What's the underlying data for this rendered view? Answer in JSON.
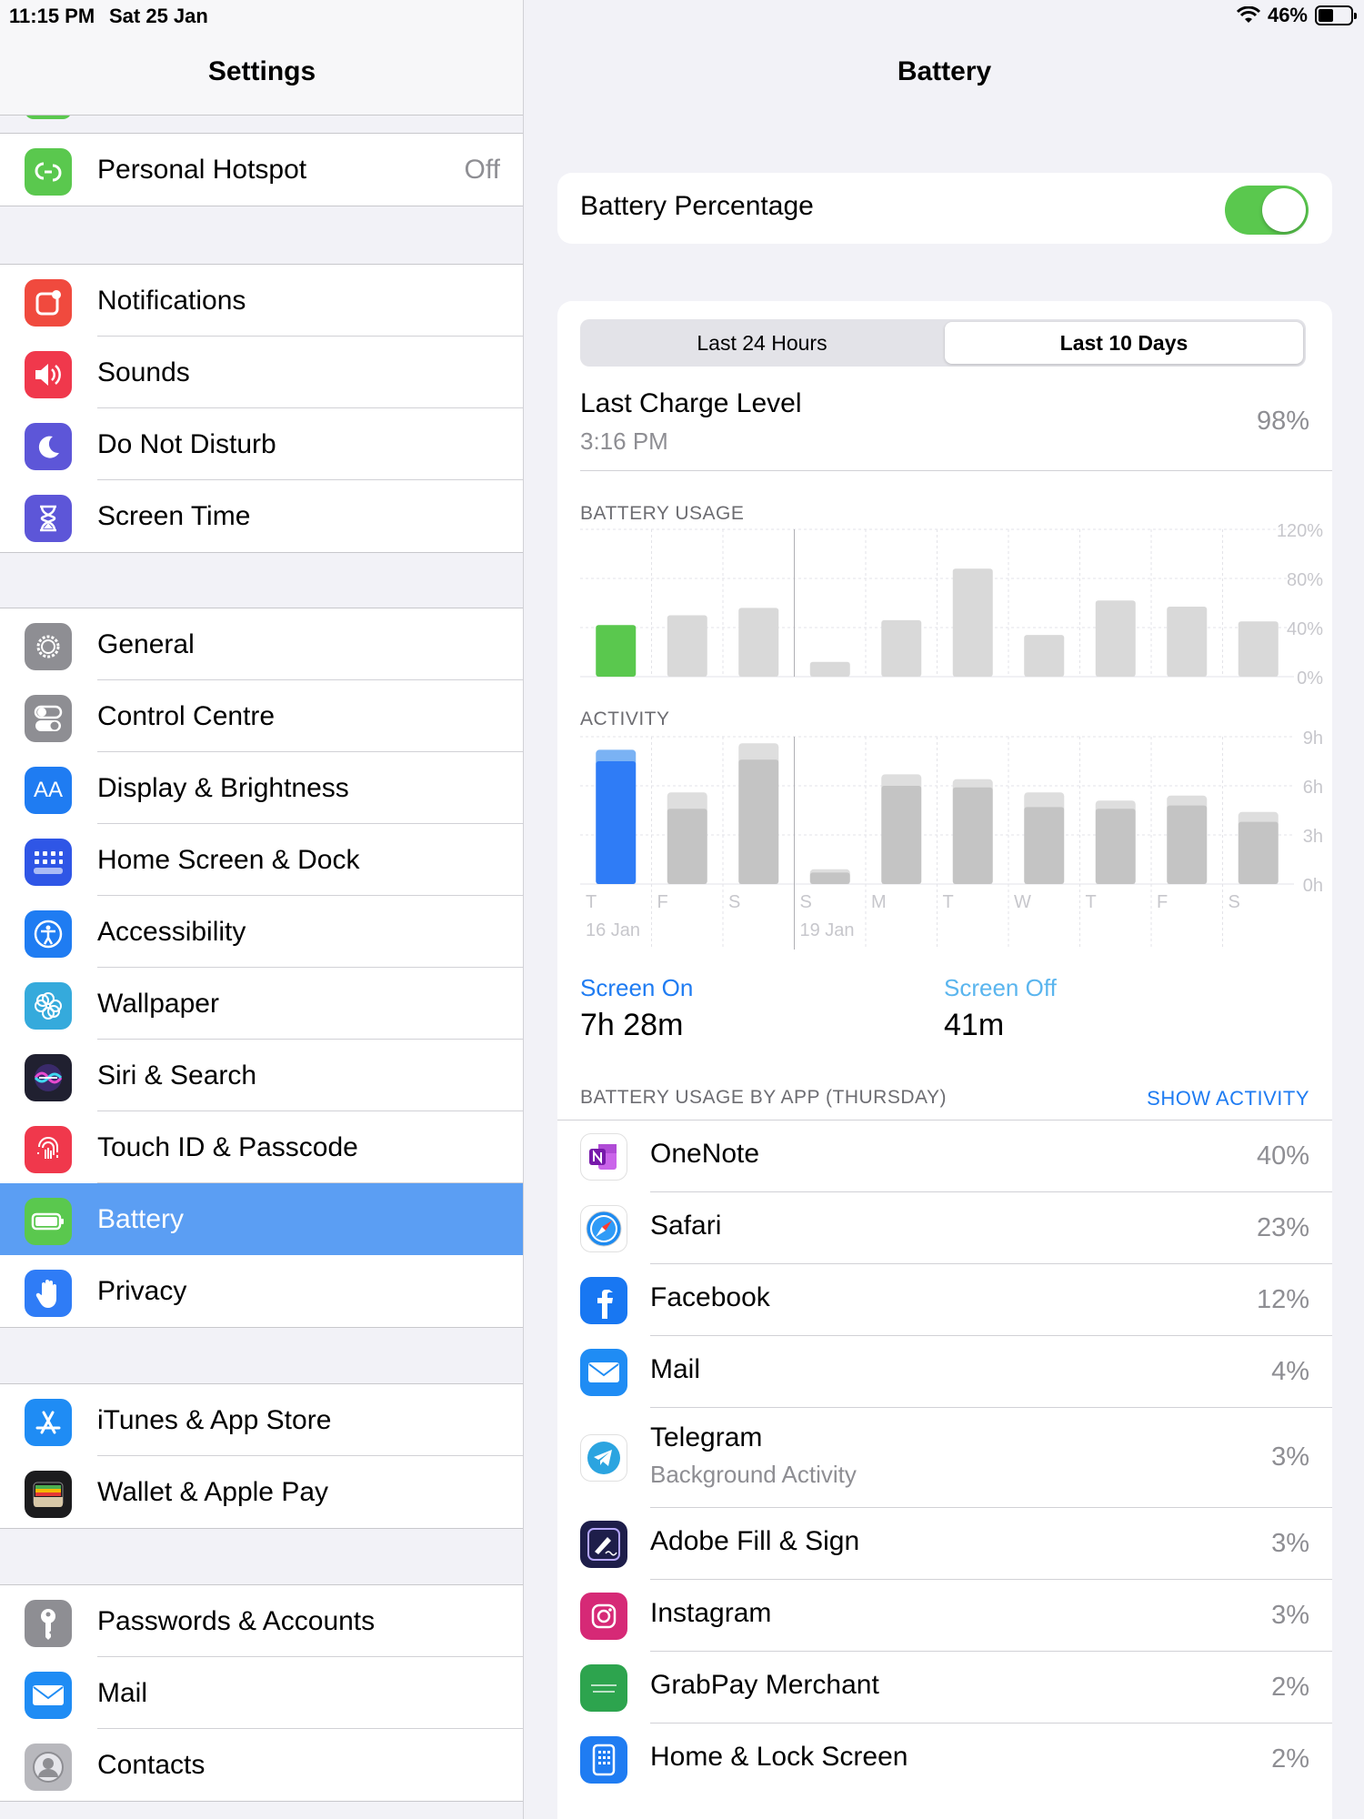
{
  "status": {
    "time": "11:15 PM",
    "date": "Sat 25 Jan",
    "battery_pct": "46%",
    "battery_level": 0.46
  },
  "sidebar": {
    "title": "Settings",
    "groups": [
      {
        "items": [
          {
            "label": "Personal Hotspot",
            "value": "Off",
            "icon": "hotspot-icon",
            "color": "#5ac84e"
          }
        ]
      },
      {
        "items": [
          {
            "label": "Notifications",
            "icon": "notifications-icon",
            "color": "#f04a3e"
          },
          {
            "label": "Sounds",
            "icon": "speaker-icon",
            "color": "#f0384c"
          },
          {
            "label": "Do Not Disturb",
            "icon": "moon-icon",
            "color": "#5d56d8"
          },
          {
            "label": "Screen Time",
            "icon": "hourglass-icon",
            "color": "#5d56d8"
          }
        ]
      },
      {
        "items": [
          {
            "label": "General",
            "icon": "gear-icon",
            "color": "#8e8e93"
          },
          {
            "label": "Control Centre",
            "icon": "toggles-icon",
            "color": "#8e8e93"
          },
          {
            "label": "Display & Brightness",
            "icon": "aa-icon",
            "color": "#1f7cf2"
          },
          {
            "label": "Home Screen & Dock",
            "icon": "grid-icon",
            "color": "#2f56e6"
          },
          {
            "label": "Accessibility",
            "icon": "accessibility-icon",
            "color": "#1f7cf2"
          },
          {
            "label": "Wallpaper",
            "icon": "flower-icon",
            "color": "#35aadc"
          },
          {
            "label": "Siri & Search",
            "icon": "siri-icon",
            "color": "#202030"
          },
          {
            "label": "Touch ID & Passcode",
            "icon": "fingerprint-icon",
            "color": "#f0384c"
          },
          {
            "label": "Battery",
            "icon": "battery-icon",
            "color": "#5ac84e",
            "selected": true
          },
          {
            "label": "Privacy",
            "icon": "hand-icon",
            "color": "#2f7cf6"
          }
        ]
      },
      {
        "items": [
          {
            "label": "iTunes & App Store",
            "icon": "appstore-icon",
            "color": "#1f8cf4"
          },
          {
            "label": "Wallet & Apple Pay",
            "icon": "wallet-icon",
            "color": "#1c1c1e"
          }
        ]
      },
      {
        "items": [
          {
            "label": "Passwords & Accounts",
            "icon": "key-icon",
            "color": "#8e8e93"
          },
          {
            "label": "Mail",
            "icon": "envelope-icon",
            "color": "#1f8cf4"
          },
          {
            "label": "Contacts",
            "icon": "contacts-icon",
            "color": "#b8b8bd"
          }
        ]
      }
    ]
  },
  "detail": {
    "title": "Battery",
    "battery_percentage_label": "Battery Percentage",
    "battery_percentage_on": true,
    "tabs": [
      "Last 24 Hours",
      "Last 10 Days"
    ],
    "active_tab": 1,
    "last_charge": {
      "label": "Last Charge Level",
      "time": "3:16 PM",
      "value": "98%"
    },
    "screen_on": {
      "label": "Screen On",
      "value": "7h 28m"
    },
    "screen_off": {
      "label": "Screen Off",
      "value": "41m"
    },
    "apps_header": "BATTERY USAGE BY APP (THURSDAY)",
    "show_activity": "SHOW ACTIVITY",
    "apps": [
      {
        "name": "OneNote",
        "pct": "40%",
        "icon": "onenote-icon",
        "color": "#ffffff"
      },
      {
        "name": "Safari",
        "pct": "23%",
        "icon": "safari-icon",
        "color": "#ffffff"
      },
      {
        "name": "Facebook",
        "pct": "12%",
        "icon": "facebook-icon",
        "color": "#1877f2"
      },
      {
        "name": "Mail",
        "pct": "4%",
        "icon": "envelope-icon",
        "color": "#1f8cf4"
      },
      {
        "name": "Telegram",
        "sub": "Background Activity",
        "pct": "3%",
        "icon": "telegram-icon",
        "color": "#ffffff"
      },
      {
        "name": "Adobe Fill & Sign",
        "pct": "3%",
        "icon": "adobe-fill-sign-icon",
        "color": "#1e1e4a"
      },
      {
        "name": "Instagram",
        "pct": "3%",
        "icon": "instagram-icon",
        "color": "#d62976"
      },
      {
        "name": "GrabPay Merchant",
        "pct": "2%",
        "icon": "grabpay-icon",
        "color": "#2da44e"
      },
      {
        "name": "Home & Lock Screen",
        "pct": "2%",
        "icon": "home-lock-icon",
        "color": "#1f7cf2"
      }
    ]
  },
  "chart_data": [
    {
      "type": "bar",
      "title": "BATTERY USAGE",
      "categories": [
        "T",
        "F",
        "S",
        "S",
        "M",
        "T",
        "W",
        "T",
        "F",
        "S"
      ],
      "date_labels": [
        {
          "index": 0,
          "text": "16 Jan"
        },
        {
          "index": 3,
          "text": "19 Jan"
        }
      ],
      "values": [
        42,
        50,
        56,
        12,
        46,
        88,
        34,
        62,
        57,
        45
      ],
      "highlight_index": 0,
      "highlight_color": "#5ac84e",
      "bar_color": "#d9d9d9",
      "yticks": [
        "120%",
        "80%",
        "40%",
        "0%"
      ],
      "ylim": [
        0,
        120
      ]
    },
    {
      "type": "bar",
      "title": "ACTIVITY",
      "categories": [
        "T",
        "F",
        "S",
        "S",
        "M",
        "T",
        "W",
        "T",
        "F",
        "S"
      ],
      "series": [
        {
          "name": "Screen On",
          "values": [
            7.5,
            4.6,
            7.6,
            0.7,
            6.0,
            5.9,
            4.7,
            4.6,
            4.8,
            3.8
          ]
        },
        {
          "name": "Screen Off",
          "values": [
            0.7,
            1.0,
            1.0,
            0.2,
            0.7,
            0.5,
            0.9,
            0.5,
            0.6,
            0.6
          ]
        }
      ],
      "highlight_index": 0,
      "highlight_colors": [
        "#2f7cf6",
        "#7ab2f4"
      ],
      "bar_colors": [
        "#c4c4c4",
        "#dedede"
      ],
      "yticks": [
        "9h",
        "6h",
        "3h",
        "0h"
      ],
      "ylim": [
        0,
        9
      ]
    }
  ]
}
